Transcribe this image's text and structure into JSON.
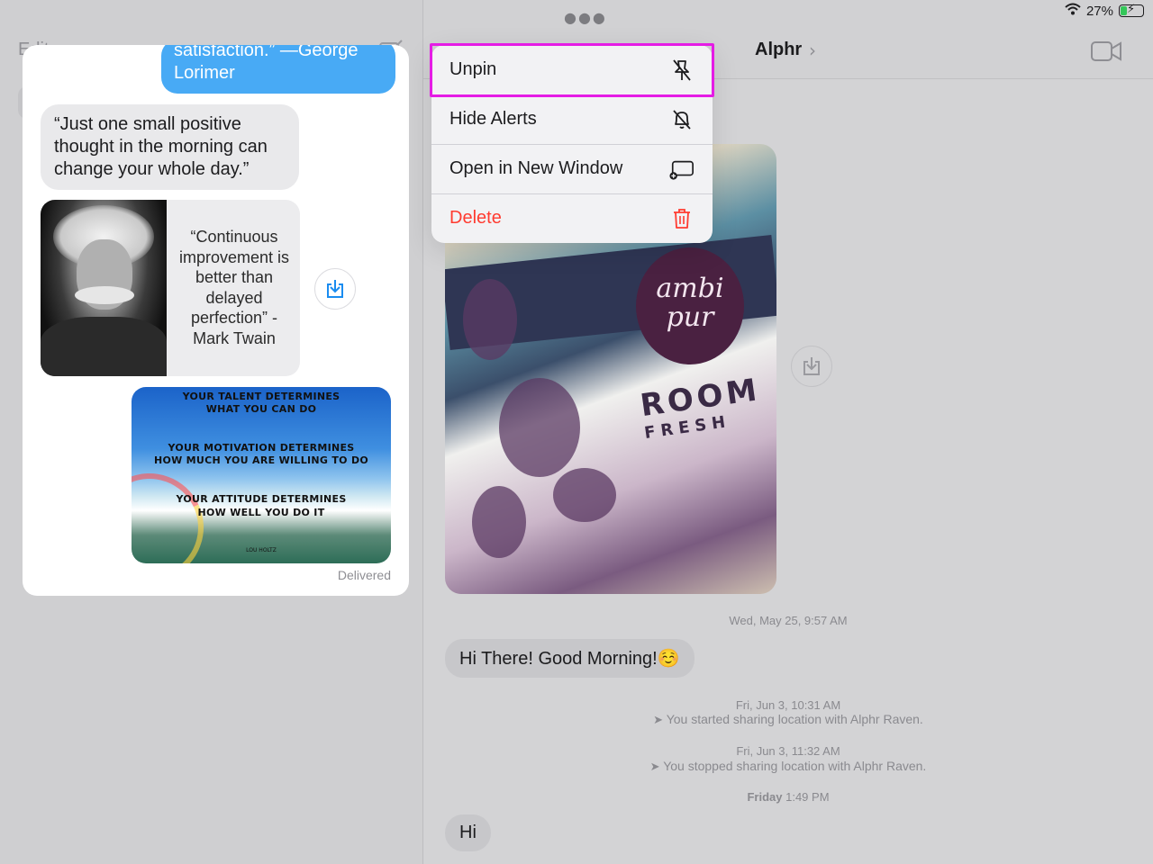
{
  "status_bar": {
    "battery": "27%"
  },
  "sidebar": {
    "edit_label": "Edit"
  },
  "conversation": {
    "contact_name": "Alphr",
    "chevron": "›",
    "image_logo": "ambi pur",
    "image_text_1": "ROOM",
    "image_text_2": "FRESH",
    "timestamp_1": "Wed, May 25, 9:57 AM",
    "message_1": "Hi There! Good Morning!☺️",
    "timestamp_2": "Fri, Jun 3, 10:31 AM",
    "system_1": "You started sharing location with Alphr Raven.",
    "timestamp_3": "Fri, Jun 3, 11:32 AM",
    "system_2": "You stopped sharing location with Alphr Raven.",
    "timestamp_4_day": "Friday",
    "timestamp_4_time": "1:49 PM",
    "message_2": "Hi"
  },
  "preview": {
    "outgoing_1": "satisfaction.” —George Lorimer",
    "incoming_1": "“Just one small positive thought in the morning can change your whole day.”",
    "quote_card_text": "“Continuous improvement is better than delayed perfection” - Mark Twain",
    "poster_lines": [
      "YOUR TALENT DETERMINES",
      "WHAT YOU CAN DO",
      "YOUR MOTIVATION DETERMINES",
      "HOW MUCH YOU ARE WILLING TO DO",
      "YOUR ATTITUDE DETERMINES",
      "HOW WELL YOU DO IT"
    ],
    "poster_signature": "LOU HOLTZ",
    "delivered": "Delivered"
  },
  "context_menu": {
    "items": [
      {
        "label": "Unpin",
        "icon": "unpin-icon"
      },
      {
        "label": "Hide Alerts",
        "icon": "bell-slash-icon"
      },
      {
        "label": "Open in New Window",
        "icon": "new-window-icon"
      },
      {
        "label": "Delete",
        "icon": "trash-icon",
        "destructive": true
      }
    ]
  },
  "colors": {
    "highlight": "#e51ce5",
    "outgoing_bubble": "#48aaf5",
    "destructive": "#ff3b30"
  }
}
